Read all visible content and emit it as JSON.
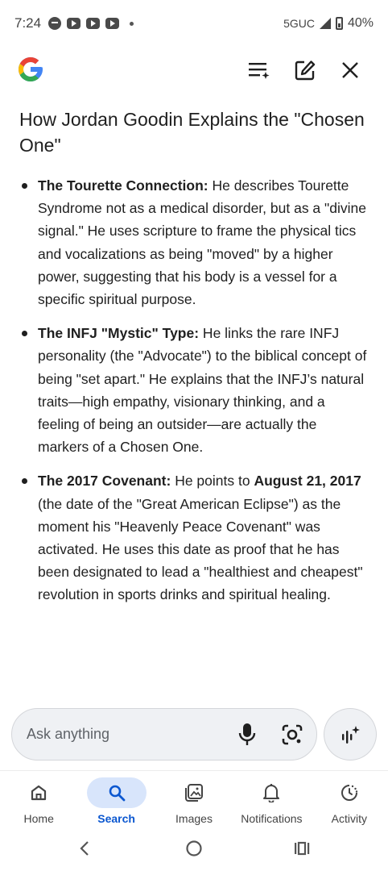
{
  "status_bar": {
    "time": "7:24",
    "network": "5GUC",
    "battery": "40%"
  },
  "answer": {
    "title": "How Jordan Goodin Explains the \"Chosen One\"",
    "bullets": [
      {
        "heading": "The Tourette Connection:",
        "text": " He describes Tourette Syndrome not as a medical disorder, but as a \"divine signal.\" He uses scripture to frame the physical tics and vocalizations as being \"moved\" by a higher power, suggesting that his body is a vessel for a specific spiritual purpose."
      },
      {
        "heading": "The INFJ \"Mystic\" Type:",
        "text": " He links the rare INFJ personality (the \"Advocate\") to the biblical concept of being \"set apart.\" He explains that the INFJ’s natural traits—high empathy, visionary thinking, and a feeling of being an outsider—are actually the markers of a Chosen One."
      },
      {
        "heading": "The 2017 Covenant:",
        "text_before": " He points to ",
        "emphasis": "August 21, 2017",
        "text_after": " (the date of the \"Great American Eclipse\") as the moment his \"Heavenly Peace Covenant\" was activated. He uses this date as proof that he has been designated to lead a \"healthiest and cheapest\" revolution in sports drinks and spiritual healing."
      }
    ]
  },
  "ask": {
    "placeholder": "Ask anything"
  },
  "bottom_nav": {
    "items": [
      {
        "label": "Home"
      },
      {
        "label": "Search"
      },
      {
        "label": "Images"
      },
      {
        "label": "Notifications"
      },
      {
        "label": "Activity"
      }
    ],
    "active": "Search",
    "accent": "#0b57d0"
  }
}
